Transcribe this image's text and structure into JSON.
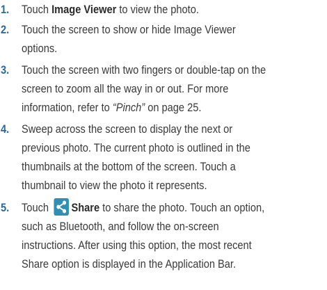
{
  "steps": [
    {
      "number": "1.",
      "pre": "Touch ",
      "bold": "Image Viewer",
      "post": " to view the photo."
    },
    {
      "number": "2.",
      "line1": "Touch the screen to show or hide Image Viewer",
      "line2": "options."
    },
    {
      "number": "3.",
      "line1": "Touch the screen with two fingers or double-tap on the",
      "line2": "screen to zoom all the way in or out. For more",
      "line3_pre": "information, refer to ",
      "line3_italic": "“Pinch”",
      "line3_post": " on page 25."
    },
    {
      "number": "4.",
      "line1": "Sweep across the screen to display the next or",
      "line2": "previous photo. The current photo is outlined in the",
      "line3": "thumbnails at the bottom of the screen. Touch a",
      "line4": "thumbnail to view the photo it represents."
    },
    {
      "number": "5.",
      "pre": "Touch ",
      "icon": "share-icon",
      "bold": "Share",
      "line1_post": " to share the photo. Touch an option,",
      "line2": "such as Bluetooth, and follow the on-screen",
      "line3": "instructions. After using this option, the most recent",
      "line4": "Share option is displayed in the Application Bar."
    }
  ],
  "colors": {
    "step_number": "#2a6a9e",
    "body_text": "#3a3a3a",
    "share_icon_bg": "#2f8fb5"
  }
}
